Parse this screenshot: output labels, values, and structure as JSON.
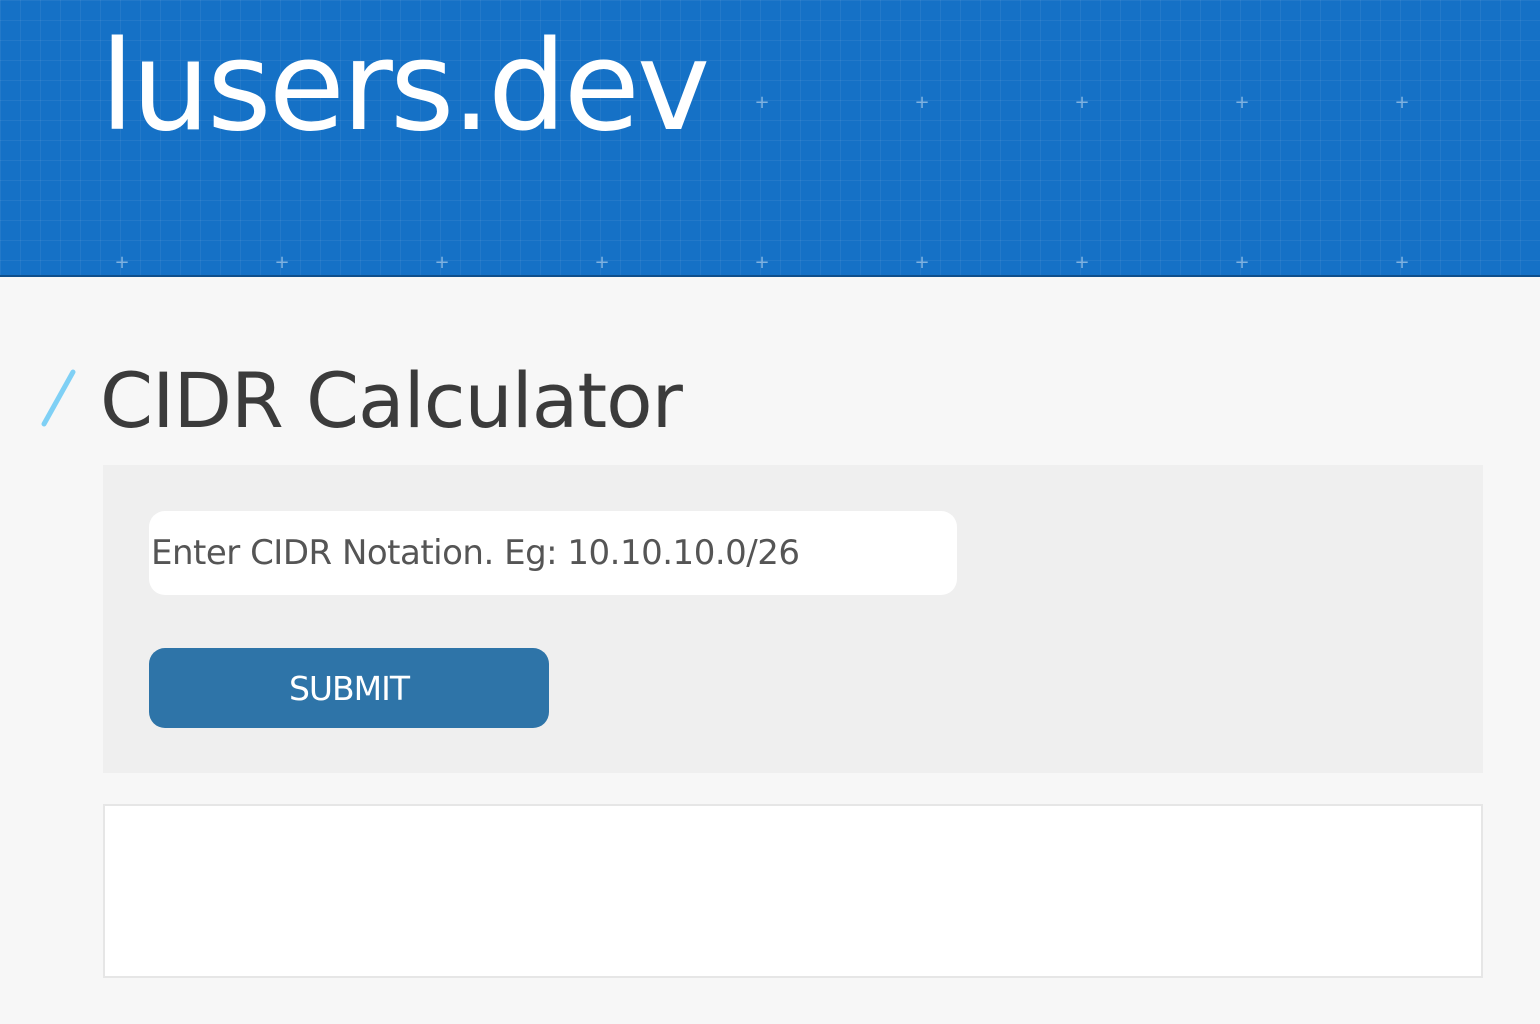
{
  "header": {
    "site_title": "lusers.dev",
    "background_color": "#1571c6",
    "grid_marker": "+"
  },
  "main": {
    "page_title": "CIDR Calculator",
    "heading_mark_color": "#7fd0f5"
  },
  "form": {
    "cidr_input": {
      "value": "",
      "placeholder": "Enter CIDR Notation. Eg: 10.10.10.0/26"
    },
    "submit_label": "SUBMIT",
    "submit_color": "#2e74a8"
  },
  "result": {
    "text": ""
  }
}
